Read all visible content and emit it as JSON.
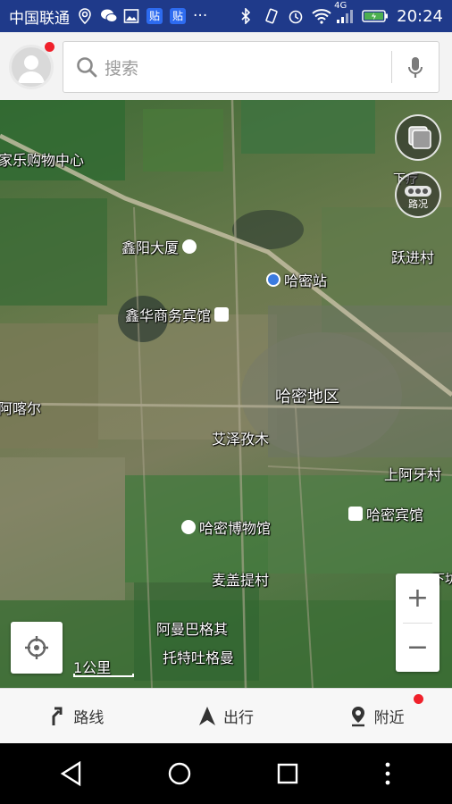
{
  "status_bar": {
    "carrier": "中国联通",
    "badges": [
      "贴",
      "贴"
    ],
    "more": "···",
    "network": "4G",
    "time": "20:24",
    "icons": [
      "location-icon",
      "wechat-icon",
      "gallery-icon",
      "bluetooth-icon",
      "vibrate-icon",
      "alarm-icon",
      "wifi-icon",
      "signal-icon",
      "battery-icon"
    ]
  },
  "header": {
    "search_placeholder": "搜索",
    "avatar_has_notification": true
  },
  "map": {
    "labels": {
      "kale": "家乐购物中心",
      "xinyang": "鑫阳大厦",
      "hamizhan": "哈密站",
      "yuejin": "跃进村",
      "xinhua": "鑫华商务宾馆",
      "ahkeer": "阿喀尔",
      "hami_region": "哈密地区",
      "aize": "艾泽孜木",
      "shangaya": "上阿牙村",
      "hami_hotel": "哈密宾馆",
      "museum": "哈密博物馆",
      "maigaiti": "麦盖提村",
      "amanbage": "阿曼巴格其",
      "tuote": "托特吐格曼",
      "partial_right_top": "下疗",
      "partial_right_bottom": "下坊"
    },
    "road_condition_label": "路况",
    "scale_label": "1公里",
    "zoom_in": "+",
    "zoom_out": "−"
  },
  "tabs": [
    {
      "label": "路线",
      "icon": "route-icon"
    },
    {
      "label": "出行",
      "icon": "navigate-arrow-icon"
    },
    {
      "label": "附近",
      "icon": "nearby-pin-icon",
      "has_notification": true
    }
  ],
  "colors": {
    "status_bar": "#1f3a8a",
    "notification": "#f0212b",
    "badge": "#2d6bf0",
    "battery": "#4caf50"
  }
}
